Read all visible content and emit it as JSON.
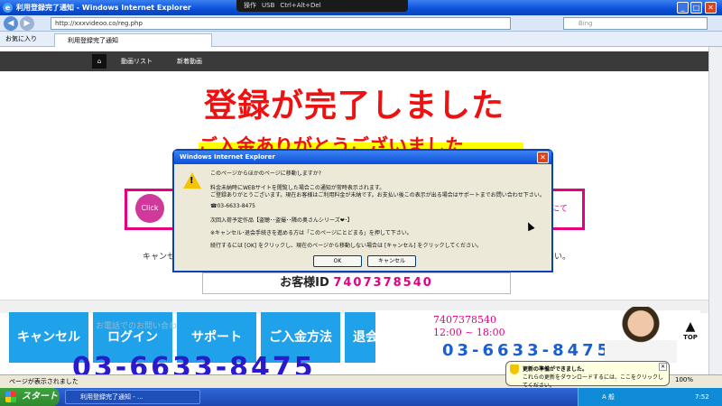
{
  "window": {
    "title": "利用登録完了通知 - Windows Internet Explorer",
    "minimize": "_",
    "maximize": "□",
    "close": "✕"
  },
  "vm_bar": {
    "menu": "操作",
    "usb": "USB",
    "ctrl_alt_del": "Ctrl+Alt+Del"
  },
  "address": {
    "back": "◀",
    "forward": "▶",
    "url": "http://xxxvideoo.co/reg.php",
    "search_placeholder": "Bing"
  },
  "favorites_label": "お気に入り",
  "tab": {
    "label": "利用登録完了通知"
  },
  "site_nav": [
    "動画リスト",
    "新着動画"
  ],
  "headline": "登録が完了しました",
  "thanks": "ご入金ありがとうございました",
  "click_icon_label": "Click",
  "pink_right": "にて",
  "cancel_text": "キャンセ",
  "cancel_text_right": "い。",
  "customer": {
    "label": "お客様ID",
    "id": "7407378540"
  },
  "buttons": [
    "キャンセル",
    "ログイン",
    "サポート",
    "ご入金方法",
    "退会手続き"
  ],
  "fade_text": "お電話でのお問い合わせはこちらから",
  "big_phone": "03-6633-8475",
  "support": {
    "id": "7407378540",
    "hours": "12:00 ~ 18:00",
    "phone": "03-6633-8475"
  },
  "top_button": "TOP",
  "dialog": {
    "title": "Windows Internet Explorer",
    "close": "✕",
    "lines": [
      "このページからほかのページに移動しますか?",
      "料金未納時にWEBサイトを閲覧した場合この通知が常時表示されます。",
      "ご登録ありがとうございます。現在お客様はご利用料金が未納です。お支払い後この表示が出る場合はサポートまでお問い合わせ下さい。",
      "☎03-6633-8475",
      "次回入荷予定作品【盗聴･･盗撮･･隣の奥さんシリーズ❤･】",
      "※キャンセル･退会手続きを進める方は「このページにとどまる」を押して下さい。",
      "続行するには [OK] をクリックし、現在のページから移動しない場合は [キャンセル] をクリックしてください。"
    ],
    "ok": "OK",
    "cancel": "キャンセル"
  },
  "status": {
    "text": "ページが表示されました",
    "zoom": "100%"
  },
  "balloon": {
    "title": "更新の準備ができました。",
    "body": "これらの更新をダウンロードするには、ここをクリックしてください。"
  },
  "taskbar": {
    "start": "スタート",
    "item": "利用登録完了通知 - ...",
    "tray_text": "A 般",
    "clock": "7:52"
  }
}
